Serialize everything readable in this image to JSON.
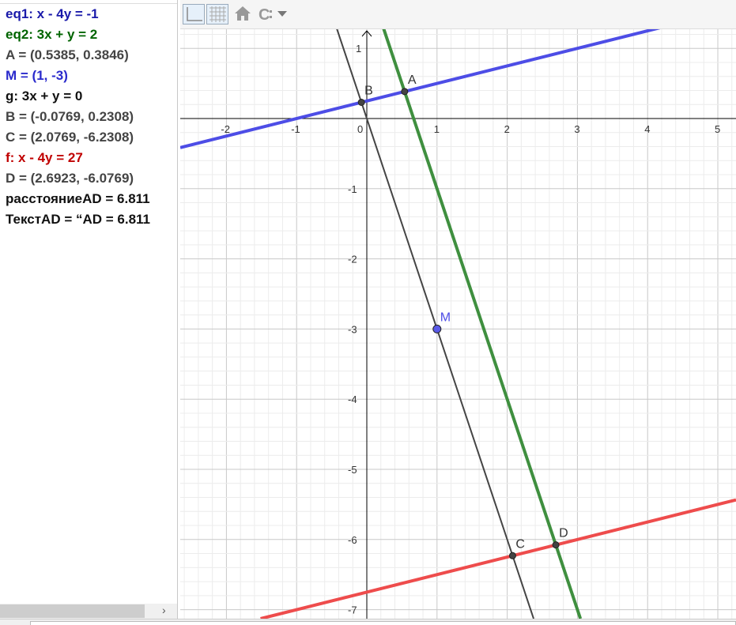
{
  "algebra": {
    "rows": [
      {
        "text": "eq1: x - 4y = -1",
        "color": "#1a1aaa"
      },
      {
        "text": "eq2: 3x + y = 2",
        "color": "#006400"
      },
      {
        "text": "A = (0.5385, 0.3846)",
        "color": "#444444"
      },
      {
        "text": "M = (1, -3)",
        "color": "#2a2acc"
      },
      {
        "text": "g: 3x + y = 0",
        "color": "#111111"
      },
      {
        "text": "B = (-0.0769, 0.2308)",
        "color": "#444444"
      },
      {
        "text": "C = (2.0769, -6.2308)",
        "color": "#444444"
      },
      {
        "text": "f: x - 4y = 27",
        "color": "#c00000"
      },
      {
        "text": "D = (2.6923, -6.0769)",
        "color": "#444444"
      },
      {
        "text": "расстояниеAD = 6.811",
        "color": "#111111"
      },
      {
        "text": "ТекстAD = “AD = 6.811",
        "color": "#111111"
      }
    ],
    "scroll_arrow": "›"
  },
  "toolbar": {
    "icons": [
      "axes-toggle-icon",
      "grid-toggle-icon",
      "home-icon",
      "point-capture-icon",
      "dropdown-arrow-icon"
    ]
  },
  "chart_data": {
    "type": "line",
    "xlim": [
      -2.7,
      5.2
    ],
    "ylim": [
      -7.1,
      1.3
    ],
    "grid": true,
    "x_ticks": [
      "-2",
      "-1",
      "0",
      "1",
      "2",
      "3",
      "4",
      "5"
    ],
    "y_ticks": [
      "1",
      "-1",
      "-2",
      "-3",
      "-4",
      "-5",
      "-6",
      "-7"
    ],
    "lines": [
      {
        "name": "eq1",
        "a": 1,
        "b": -4,
        "c": -1,
        "color": "#4d4de6"
      },
      {
        "name": "eq2",
        "a": 3,
        "b": 1,
        "c": 2,
        "color": "#3f8f3f"
      },
      {
        "name": "g",
        "a": 3,
        "b": 1,
        "c": 0,
        "color": "#444444"
      },
      {
        "name": "f",
        "a": 1,
        "b": -4,
        "c": 27,
        "color": "#ee4c4c"
      }
    ],
    "points": [
      {
        "label": "A",
        "x": 0.5385,
        "y": 0.3846,
        "color": "#444444"
      },
      {
        "label": "B",
        "x": -0.0769,
        "y": 0.2308,
        "color": "#444444"
      },
      {
        "label": "C",
        "x": 2.0769,
        "y": -6.2308,
        "color": "#444444"
      },
      {
        "label": "D",
        "x": 2.6923,
        "y": -6.0769,
        "color": "#444444"
      },
      {
        "label": "M",
        "x": 1,
        "y": -3,
        "color": "#4d4de6"
      }
    ]
  }
}
